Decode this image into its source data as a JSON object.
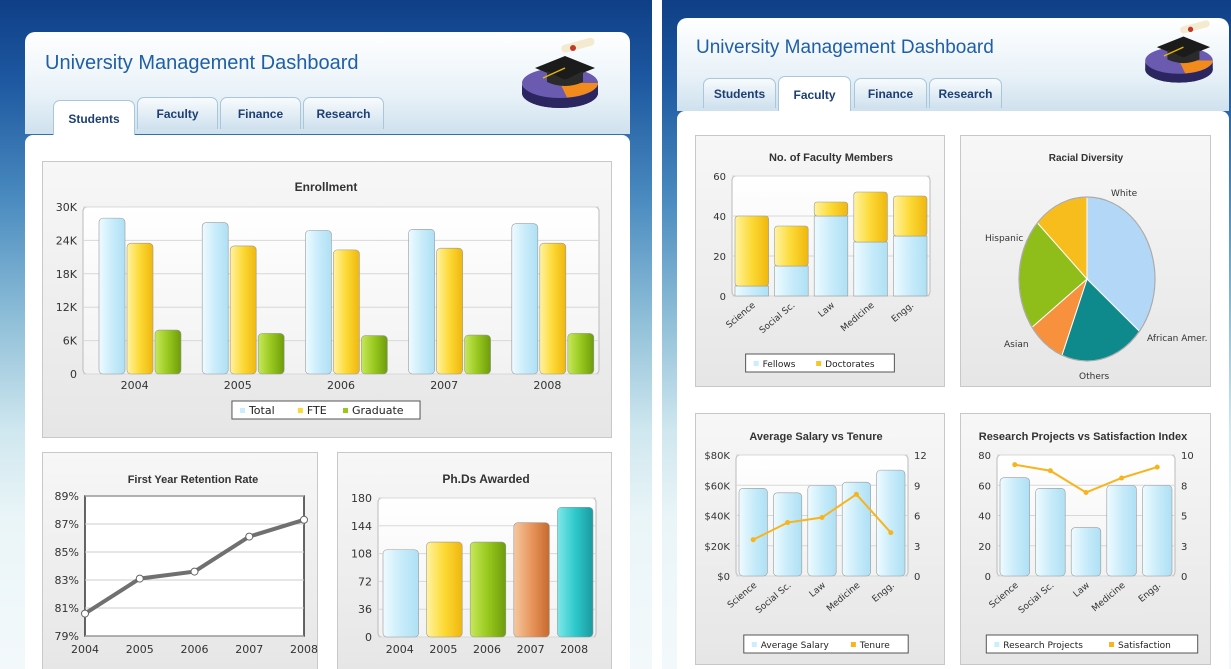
{
  "app": {
    "title": "University Management Dashboard"
  },
  "tabs": [
    "Students",
    "Faculty",
    "Finance",
    "Research"
  ],
  "colors": {
    "total": "#cbeefb",
    "fte": "#fcd935",
    "graduate": "#98c81e",
    "fellows": "#cbeefb",
    "doctorates": "#f7c42d",
    "line": "#707070",
    "tenure": "#f7b41c"
  },
  "icons": {
    "logo": "graduation-cap-pie-icon"
  },
  "chart_data": [
    {
      "id": "enrollment",
      "type": "bar",
      "title": "Enrollment",
      "categories": [
        "2004",
        "2005",
        "2006",
        "2007",
        "2008"
      ],
      "series": [
        {
          "name": "Total",
          "values": [
            28000,
            27200,
            25800,
            26000,
            27000
          ]
        },
        {
          "name": "FTE",
          "values": [
            23500,
            23000,
            22300,
            22600,
            23500
          ]
        },
        {
          "name": "Graduate",
          "values": [
            7900,
            7300,
            6900,
            7000,
            7300
          ]
        }
      ],
      "ylim": [
        0,
        30000
      ],
      "yticks": [
        "0",
        "6K",
        "12K",
        "18K",
        "24K",
        "30K"
      ],
      "legend": "bottom"
    },
    {
      "id": "retention",
      "type": "line",
      "title": "First Year Retention Rate",
      "categories": [
        "2004",
        "2005",
        "2006",
        "2007",
        "2008"
      ],
      "values": [
        80.6,
        83.1,
        83.6,
        86.1,
        87.3
      ],
      "ylim": [
        79,
        89
      ],
      "yticks": [
        "79%",
        "81%",
        "83%",
        "85%",
        "87%",
        "89%"
      ]
    },
    {
      "id": "phds",
      "type": "bar",
      "title": "Ph.Ds Awarded",
      "categories": [
        "2004",
        "2005",
        "2006",
        "2007",
        "2008"
      ],
      "values": [
        113,
        123,
        123,
        148,
        168
      ],
      "ylim": [
        0,
        180
      ],
      "yticks": [
        "0",
        "36",
        "72",
        "108",
        "144",
        "180"
      ]
    },
    {
      "id": "faculty",
      "type": "bar",
      "title": "No. of Faculty Members",
      "stacked": true,
      "categories": [
        "Science",
        "Social Sc.",
        "Law",
        "Medicine",
        "Engg."
      ],
      "series": [
        {
          "name": "Fellows",
          "values": [
            5,
            15,
            40,
            27,
            30
          ]
        },
        {
          "name": "Doctorates",
          "values": [
            35,
            20,
            7,
            25,
            20
          ]
        }
      ],
      "ylim": [
        0,
        60
      ],
      "yticks": [
        "0",
        "20",
        "40",
        "60"
      ],
      "legend": "bottom"
    },
    {
      "id": "diversity",
      "type": "pie",
      "title": "Racial Diversity",
      "labels": [
        "White",
        "African Amer.",
        "Others",
        "Asian",
        "Hispanic"
      ],
      "values": [
        36,
        20,
        9,
        22,
        13
      ]
    },
    {
      "id": "salary",
      "type": "bar",
      "title": "Average Salary vs Tenure",
      "categories": [
        "Science",
        "Social Sc.",
        "Law",
        "Medicine",
        "Engg."
      ],
      "series": [
        {
          "name": "Average Salary",
          "values": [
            58000,
            55000,
            60000,
            62000,
            70000
          ]
        },
        {
          "name": "Tenure",
          "values": [
            3.6,
            5.3,
            5.8,
            8.1,
            4.3
          ],
          "axis": "right"
        }
      ],
      "ylim": [
        0,
        80000
      ],
      "yticks": [
        "$0",
        "$20K",
        "$40K",
        "$60K",
        "$80K"
      ],
      "y2lim": [
        0,
        12
      ],
      "y2ticks": [
        "0",
        "3",
        "6",
        "9",
        "12"
      ],
      "legend": "bottom"
    },
    {
      "id": "research",
      "type": "bar",
      "title": "Research Projects vs Satisfaction Index",
      "categories": [
        "Science",
        "Social Sc.",
        "Law",
        "Medicine",
        "Engg."
      ],
      "series": [
        {
          "name": "Research Projects",
          "values": [
            65,
            58,
            32,
            60,
            60
          ]
        },
        {
          "name": "Satisfaction",
          "values": [
            9.2,
            8.7,
            6.9,
            8.1,
            9.0
          ],
          "axis": "right"
        }
      ],
      "ylim": [
        0,
        80
      ],
      "yticks": [
        "0",
        "20",
        "40",
        "60",
        "80"
      ],
      "y2lim": [
        0,
        10
      ],
      "y2ticks": [
        "0",
        "3",
        "5",
        "8",
        "10"
      ],
      "legend": "bottom"
    }
  ]
}
